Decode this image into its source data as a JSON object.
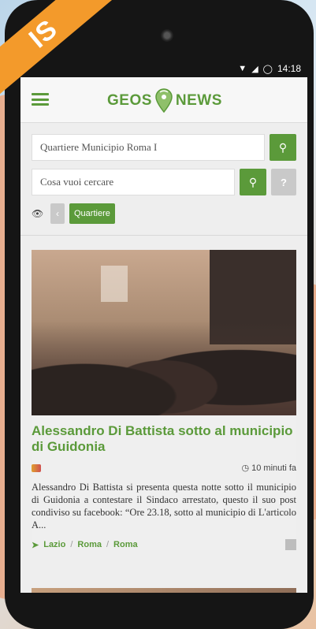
{
  "ribbon": {
    "text": "IS"
  },
  "status_bar": {
    "time": "14:18",
    "icons": [
      "wifi-icon",
      "signal-icon",
      "sync-icon"
    ]
  },
  "app": {
    "logo_left": "GEOS",
    "logo_right": "NEWS"
  },
  "search": {
    "location_value": "Quartiere Municipio Roma I",
    "query_placeholder": "Cosa vuoi cercare",
    "help_label": "?"
  },
  "filters": {
    "active_tag": "Quartiere"
  },
  "article": {
    "title": "Alessandro Di Battista sotto al municipio di Guidonia",
    "time_ago": "10 minuti fa",
    "excerpt": "Alessandro Di Battista si presenta questa notte sotto il municipio di Guidonia a contestare il Sindaco arrestato, questo il suo post condiviso su facebook: “Ore 23.18, sotto al municipio di L'articolo A...",
    "breadcrumb": [
      "Lazio",
      "Roma",
      "Roma"
    ]
  },
  "colors": {
    "accent": "#5b9a3a",
    "ribbon": "#f39a2b"
  }
}
